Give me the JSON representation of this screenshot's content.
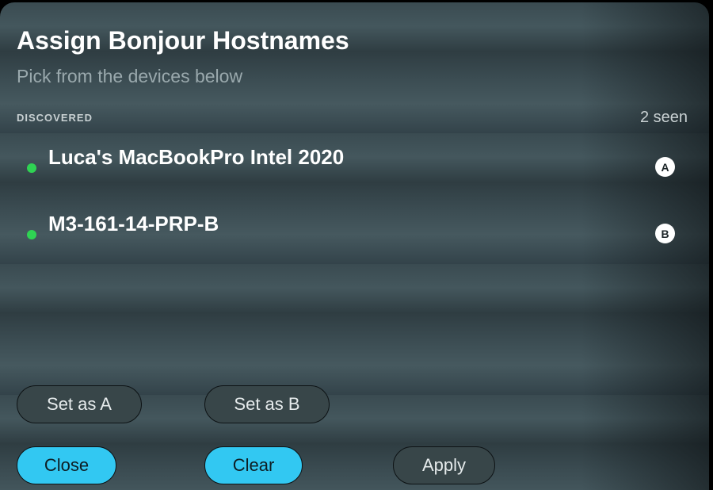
{
  "dialog": {
    "title": "Assign Bonjour Hostnames",
    "subtitle": "Pick from the devices below"
  },
  "section": {
    "label": "DISCOVERED",
    "count": "2 seen"
  },
  "devices": [
    {
      "name": "Luca's MacBookPro Intel 2020",
      "slot": "A",
      "status_color": "#2fd353"
    },
    {
      "name": "M3-161-14-PRP-B",
      "slot": "B",
      "status_color": "#2fd353"
    }
  ],
  "actions": {
    "set_a": "Set as A",
    "set_b": "Set as B",
    "close": "Close",
    "clear": "Clear",
    "apply": "Apply"
  },
  "colors": {
    "accent": "#32c8f2",
    "status_online": "#2fd353"
  }
}
